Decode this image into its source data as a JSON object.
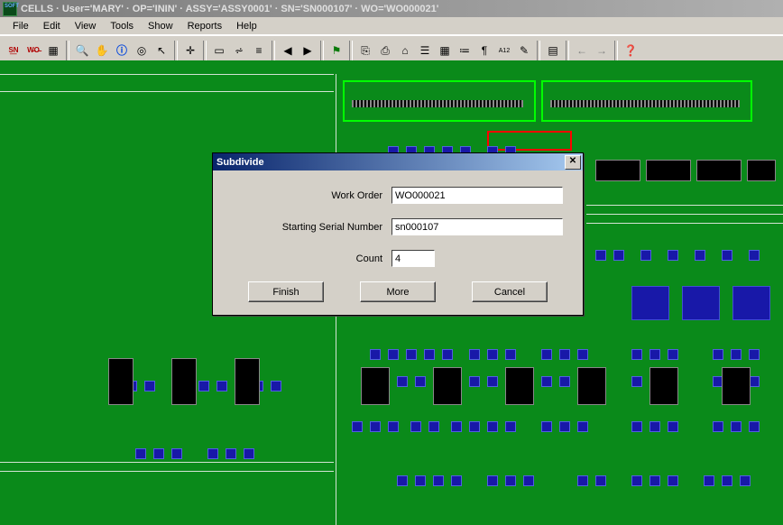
{
  "title": "CELLS · User='MARY' · OP='ININ' · ASSY='ASSY0001' · SN='SN000107' · WO='WO000021'",
  "menus": [
    "File",
    "Edit",
    "View",
    "Tools",
    "Show",
    "Reports",
    "Help"
  ],
  "toolbar_groups": [
    [
      "sn-icon",
      "wo-icon",
      "list-icon"
    ],
    [
      "zoom-icon",
      "hand-icon",
      "info-icon",
      "target-icon",
      "arrow-icon"
    ],
    [
      "crosshair-icon"
    ],
    [
      "layer1-icon",
      "layer2-icon",
      "layer3-icon"
    ],
    [
      "prev-icon",
      "next-icon"
    ],
    [
      "flag-icon"
    ],
    [
      "tool-a-icon",
      "tool-b-icon",
      "tool-c-icon",
      "tool-d-icon",
      "grid-icon",
      "props-icon",
      "key-icon",
      "a12-icon",
      "note-icon"
    ],
    [
      "calendar-icon"
    ],
    [
      "back-icon",
      "forward-icon"
    ],
    [
      "help-icon"
    ]
  ],
  "dialog": {
    "title": "Subdivide",
    "fields": {
      "work_order": {
        "label": "Work Order",
        "value": "WO000021"
      },
      "starting_sn": {
        "label": "Starting Serial Number",
        "value": "sn000107"
      },
      "count": {
        "label": "Count",
        "value": "4"
      }
    },
    "buttons": {
      "finish": "Finish",
      "more": "More",
      "cancel": "Cancel"
    }
  },
  "icon_glyphs": {
    "sn-icon": "S͟N",
    "wo-icon": "W̶O̶",
    "list-icon": "▦",
    "zoom-icon": "🔍",
    "hand-icon": "✋",
    "info-icon": "ⓘ",
    "target-icon": "◎",
    "arrow-icon": "↖",
    "crosshair-icon": "✛",
    "layer1-icon": "▭",
    "layer2-icon": "⩫",
    "layer3-icon": "≡",
    "prev-icon": "◀",
    "next-icon": "▶",
    "flag-icon": "⚑",
    "tool-a-icon": "⎘",
    "tool-b-icon": "⎙",
    "tool-c-icon": "⌂",
    "tool-d-icon": "☰",
    "grid-icon": "▦",
    "props-icon": "≔",
    "key-icon": "¶",
    "a12-icon": "A12",
    "note-icon": "✎",
    "calendar-icon": "▤",
    "back-icon": "←",
    "forward-icon": "→",
    "help-icon": "❓"
  }
}
